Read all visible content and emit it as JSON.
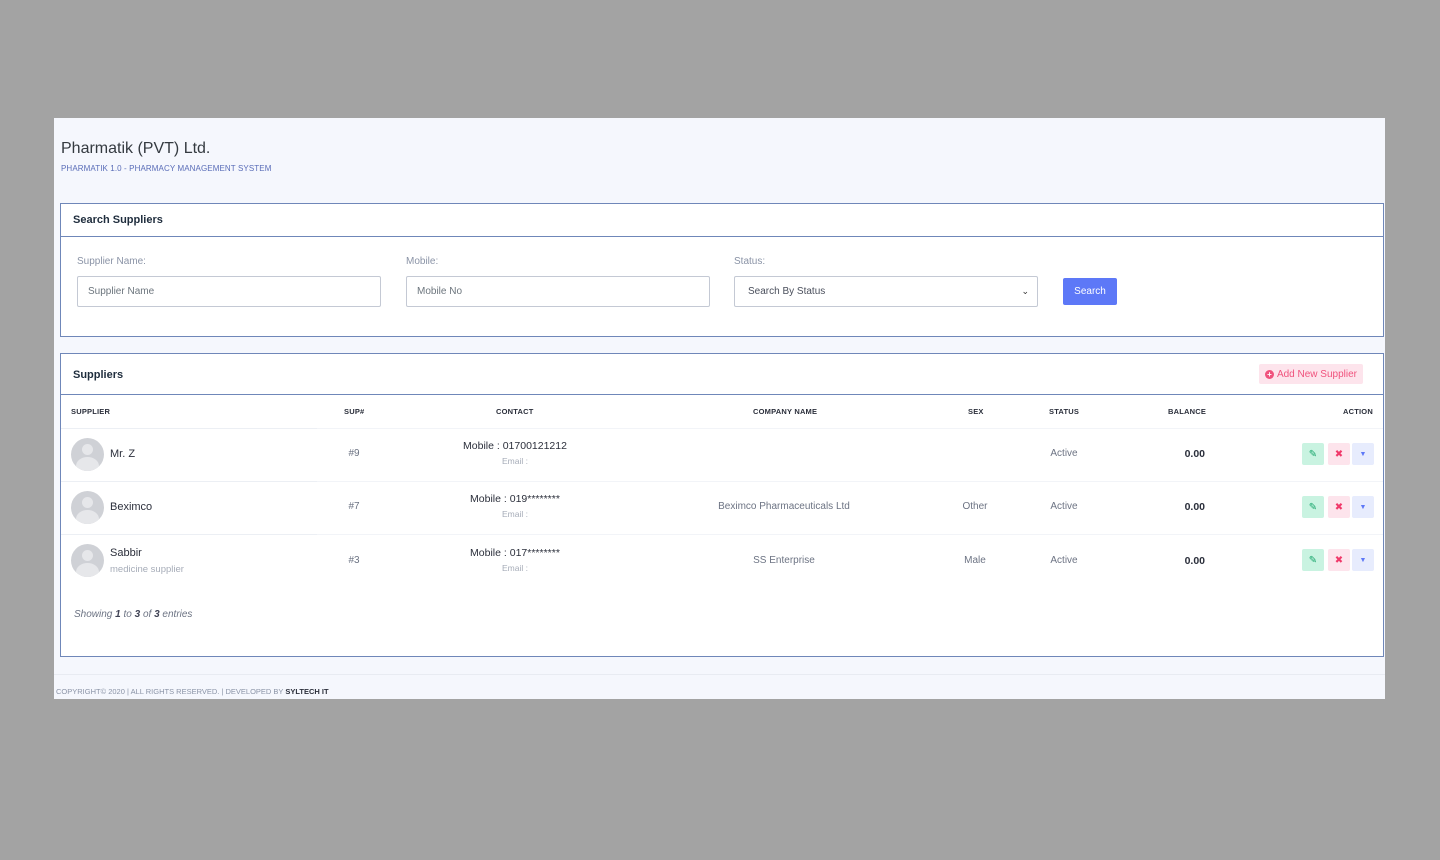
{
  "header": {
    "title": "Pharmatik (PVT) Ltd.",
    "subtitle": "PHARMATIK 1.0 - PHARMACY MANAGEMENT SYSTEM"
  },
  "search": {
    "card_title": "Search Suppliers",
    "name_label": "Supplier Name:",
    "name_placeholder": "Supplier Name",
    "mobile_label": "Mobile:",
    "mobile_placeholder": "Mobile No",
    "status_label": "Status:",
    "status_selected": "Search By Status",
    "button_label": "Search"
  },
  "suppliers": {
    "card_title": "Suppliers",
    "add_button_label": "Add New Supplier",
    "columns": {
      "supplier": "SUPPLIER",
      "sup_no": "SUP#",
      "contact": "CONTACT",
      "company": "COMPANY NAME",
      "sex": "SEX",
      "status": "STATUS",
      "balance": "BALANCE",
      "action": "ACTION"
    },
    "rows": [
      {
        "name": "Mr. Z",
        "note": "",
        "sup_no": "#9",
        "mobile": "Mobile : 01700121212",
        "email": "Email :",
        "company": "",
        "sex": "",
        "status": "Active",
        "balance": "0.00"
      },
      {
        "name": "Beximco",
        "note": "",
        "sup_no": "#7",
        "mobile": "Mobile : 019********",
        "email": "Email :",
        "company": "Beximco Pharmaceuticals Ltd",
        "sex": "Other",
        "status": "Active",
        "balance": "0.00"
      },
      {
        "name": "Sabbir",
        "note": "medicine supplier",
        "sup_no": "#3",
        "mobile": "Mobile : 017********",
        "email": "Email :",
        "company": "SS Enterprise",
        "sex": "Male",
        "status": "Active",
        "balance": "0.00"
      }
    ],
    "entries": {
      "prefix": "Showing",
      "from": "1",
      "to_word": "to",
      "to": "3",
      "of_word": "of",
      "total": "3",
      "suffix": "entries"
    }
  },
  "footer": {
    "text": "COPYRIGHT© 2020 | ALL RIGHTS RESERVED. | DEVELOPED BY",
    "developer": "SYLTECH IT"
  },
  "colors": {
    "primary": "#5d78f7",
    "danger": "#f0527d",
    "success": "#17a56b",
    "card_border": "#6f87b9"
  }
}
